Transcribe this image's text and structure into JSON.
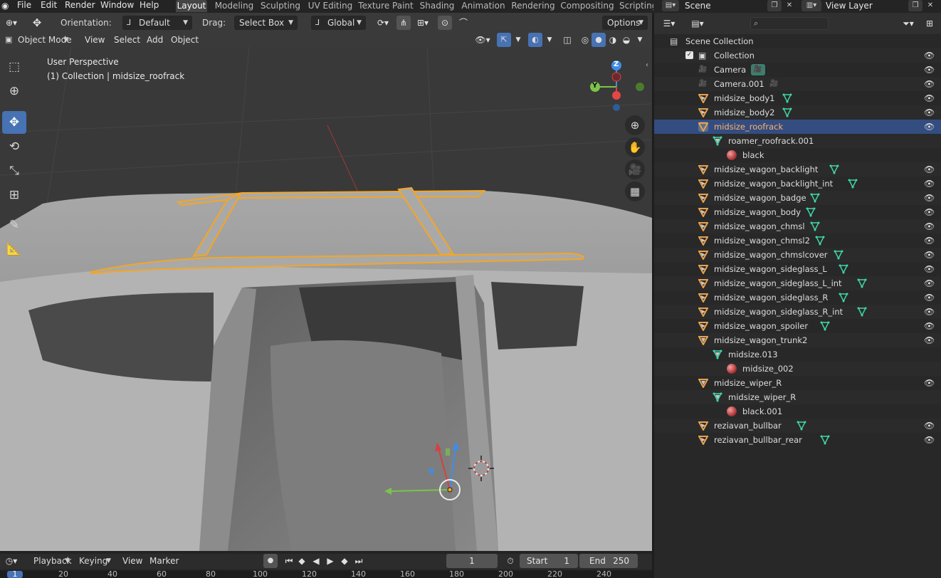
{
  "menu": [
    "File",
    "Edit",
    "Render",
    "Window",
    "Help"
  ],
  "workspaces": [
    "Layout",
    "Modeling",
    "Sculpting",
    "UV Editing",
    "Texture Paint",
    "Shading",
    "Animation",
    "Rendering",
    "Compositing",
    "Scripting"
  ],
  "active_workspace": "Layout",
  "scene": {
    "name": "Scene",
    "view_layer": "View Layer"
  },
  "viewport_header": {
    "orientation_label": "Orientation:",
    "orientation_value": "Default",
    "drag_label": "Drag:",
    "drag_value": "Select Box",
    "transform_space": "Global",
    "options": "Options",
    "mode": "Object Mode",
    "menus": [
      "View",
      "Select",
      "Add",
      "Object"
    ]
  },
  "viewport": {
    "perspective": "User Perspective",
    "context": "(1) Collection | midsize_roofrack",
    "gizmo_axes": [
      "Z",
      "Y"
    ]
  },
  "timeline": {
    "menus": [
      "Playback",
      "Keying",
      "View",
      "Marker"
    ],
    "current_frame": "1",
    "start_label": "Start",
    "start_value": "1",
    "end_label": "End",
    "end_value": "250",
    "ruler": [
      "1",
      "20",
      "40",
      "60",
      "80",
      "100",
      "120",
      "140",
      "160",
      "180",
      "200",
      "220",
      "240"
    ]
  },
  "outliner": {
    "rows": [
      {
        "label": "Scene Collection",
        "kind": "scene",
        "depth": 0
      },
      {
        "label": "Collection",
        "kind": "collection",
        "depth": 1,
        "expanded": true
      },
      {
        "label": "Camera",
        "kind": "camera",
        "depth": 2
      },
      {
        "label": "Camera.001",
        "kind": "camera",
        "depth": 2
      },
      {
        "label": "midsize_body1",
        "kind": "object",
        "depth": 2
      },
      {
        "label": "midsize_body2",
        "kind": "object",
        "depth": 2
      },
      {
        "label": "midsize_roofrack",
        "kind": "object",
        "depth": 2,
        "selected": true,
        "expanded": true
      },
      {
        "label": "roamer_roofrack.001",
        "kind": "mesh",
        "depth": 3,
        "expanded": true
      },
      {
        "label": "black",
        "kind": "material",
        "depth": 4
      },
      {
        "label": "midsize_wagon_backlight",
        "kind": "object",
        "depth": 2
      },
      {
        "label": "midsize_wagon_backlight_int",
        "kind": "object",
        "depth": 2
      },
      {
        "label": "midsize_wagon_badge",
        "kind": "object",
        "depth": 2
      },
      {
        "label": "midsize_wagon_body",
        "kind": "object",
        "depth": 2
      },
      {
        "label": "midsize_wagon_chmsl",
        "kind": "object",
        "depth": 2
      },
      {
        "label": "midsize_wagon_chmsl2",
        "kind": "object",
        "depth": 2
      },
      {
        "label": "midsize_wagon_chmslcover",
        "kind": "object",
        "depth": 2
      },
      {
        "label": "midsize_wagon_sideglass_L",
        "kind": "object",
        "depth": 2
      },
      {
        "label": "midsize_wagon_sideglass_L_int",
        "kind": "object",
        "depth": 2
      },
      {
        "label": "midsize_wagon_sideglass_R",
        "kind": "object",
        "depth": 2
      },
      {
        "label": "midsize_wagon_sideglass_R_int",
        "kind": "object",
        "depth": 2
      },
      {
        "label": "midsize_wagon_spoiler",
        "kind": "object",
        "depth": 2
      },
      {
        "label": "midsize_wagon_trunk2",
        "kind": "object",
        "depth": 2,
        "expanded": true
      },
      {
        "label": "midsize.013",
        "kind": "mesh",
        "depth": 3,
        "expanded": true
      },
      {
        "label": "midsize_002",
        "kind": "material",
        "depth": 4
      },
      {
        "label": "midsize_wiper_R",
        "kind": "object",
        "depth": 2,
        "expanded": true
      },
      {
        "label": "midsize_wiper_R",
        "kind": "mesh",
        "depth": 3,
        "expanded": true
      },
      {
        "label": "black.001",
        "kind": "material",
        "depth": 4
      },
      {
        "label": "reziavan_bullbar",
        "kind": "object",
        "depth": 2
      },
      {
        "label": "reziavan_bullbar_rear",
        "kind": "object",
        "depth": 2
      }
    ]
  },
  "colors": {
    "accent": "#4772b3",
    "selection_text": "#ffb16b",
    "object_icon": "#e8a24d",
    "mesh_icon": "#3fd6a8",
    "outline": "#f5a623"
  }
}
